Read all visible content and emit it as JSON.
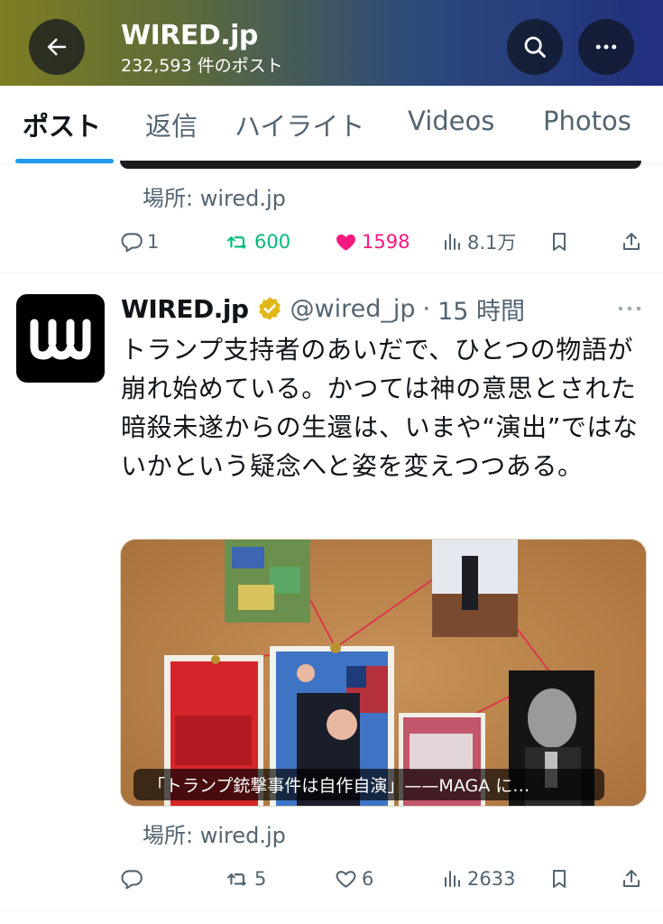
{
  "header": {
    "title": "WIRED.jp",
    "subtitle": "232,593 件のポスト"
  },
  "tabs": [
    {
      "label": "ポスト",
      "active": true
    },
    {
      "label": "返信"
    },
    {
      "label": "ハイライト"
    },
    {
      "label": "Videos"
    },
    {
      "label": "Photos"
    }
  ],
  "posts": [
    {
      "location": "場所: wired.jp",
      "replies": "1",
      "reposts": "600",
      "likes": "1598",
      "views": "8.1万"
    },
    {
      "author": "WIRED.jp",
      "handle": "@wired_jp",
      "separator": "·",
      "time": "15 時間",
      "text": "トランプ支持者のあいだで、ひとつの物語が崩れ始めている。かつては神の意思とされた暗殺未遂からの生還は、いまや“演出”ではないかという疑念へと姿を変えつつある。",
      "caption": "「トランプ銃撃事件は自作自演」——MAGA に…",
      "location": "場所: wired.jp",
      "replies": "",
      "reposts": "5",
      "likes": "6",
      "views": "2633"
    }
  ],
  "colors": {
    "accent": "#1d9bf0",
    "repost_active": "#00ba7c",
    "like_active": "#f91880",
    "verified_badge": "#e2b719",
    "muted_text": "#536471"
  },
  "icons": {
    "back": "arrow-left-icon",
    "search": "search-icon",
    "more": "more-icon",
    "reply": "reply-icon",
    "repost": "repost-icon",
    "like": "heart-icon",
    "views": "views-icon",
    "bookmark": "bookmark-icon",
    "share": "share-icon",
    "verified": "verified-badge-icon"
  }
}
